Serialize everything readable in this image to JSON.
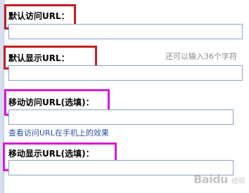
{
  "fields": {
    "default_visit_url": {
      "label": "默认访问URL：",
      "value": ""
    },
    "default_display_url": {
      "label": "默认显示URL：",
      "value": "",
      "hint": "还可以输入36个字符"
    },
    "mobile_visit_url": {
      "label": "移动访问URL(选填)：",
      "value": "",
      "link": "查看访问URL在手机上的效果"
    },
    "mobile_display_url": {
      "label": "移动显示URL(选填)：",
      "value": ""
    }
  },
  "watermark": {
    "brand": "Baidu",
    "sub": "经验"
  },
  "colors": {
    "highlight_red": "#c41d1d",
    "highlight_magenta": "#d81ad8",
    "input_border": "#8ba1c9",
    "link": "#2a4fa8",
    "hint": "#8a8a8a"
  }
}
